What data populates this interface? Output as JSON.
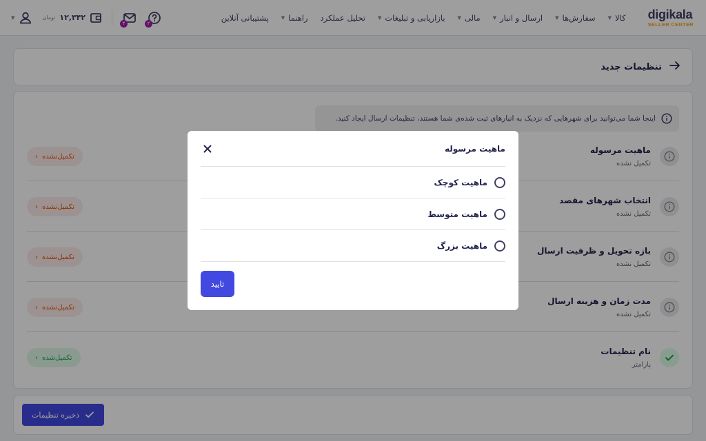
{
  "header": {
    "logo_main": "digikala",
    "logo_sub": "SELLER CENTER",
    "nav": [
      {
        "label": "کالا",
        "caret": true
      },
      {
        "label": "سفارش‌ها",
        "caret": true
      },
      {
        "label": "ارسال و انبار",
        "caret": true
      },
      {
        "label": "مالی",
        "caret": true
      },
      {
        "label": "بازاریابی و تبلیغات",
        "caret": true
      },
      {
        "label": "تحلیل عملکرد",
        "caret": false
      },
      {
        "label": "راهنما",
        "caret": true
      },
      {
        "label": "پشتیبانی آنلاین",
        "caret": false
      }
    ],
    "help_badge": "۲",
    "mail_badge": "۴",
    "wallet_amount": "۱۲,۳۴۲",
    "wallet_unit": "تومان"
  },
  "page": {
    "title": "تنظیمات جدید",
    "info_text": "اینجا شما می‌توانید برای شهرهایی که نزدیک به انبارهای ثبت شده‌ی شما هستند، تنظیمات ارسال ایجاد کنید.",
    "rows": [
      {
        "title": "ماهیت مرسوله",
        "subtitle": "تکمیل نشده",
        "status": "تکمیل‌نشده",
        "done": false
      },
      {
        "title": "انتخاب شهرهای مقصد",
        "subtitle": "تکمیل نشده",
        "status": "تکمیل‌نشده",
        "done": false
      },
      {
        "title": "بازه تحویل و ظرفیت ارسال",
        "subtitle": "تکمیل نشده",
        "status": "تکمیل‌نشده",
        "done": false
      },
      {
        "title": "مدت زمان و هزینه ارسال",
        "subtitle": "تکمیل نشده",
        "status": "تکمیل‌نشده",
        "done": false
      },
      {
        "title": "نام تنظیمات",
        "subtitle": "پارامتر",
        "status": "تکمیل‌شده",
        "done": true
      }
    ],
    "save_label": "ذخیره تنظیمات"
  },
  "modal": {
    "title": "ماهیت مرسوله",
    "options": [
      "ماهیت کوچک",
      "ماهیت متوسط",
      "ماهیت بزرگ"
    ],
    "confirm_label": "تایید"
  },
  "colors": {
    "primary": "#4149e0",
    "logo_accent": "#f9a825",
    "pending_text": "#e65100",
    "pending_bg": "#fcecec",
    "done_text": "#16a34a",
    "done_bg": "#e1f8e8",
    "badge": "#a21caf"
  }
}
